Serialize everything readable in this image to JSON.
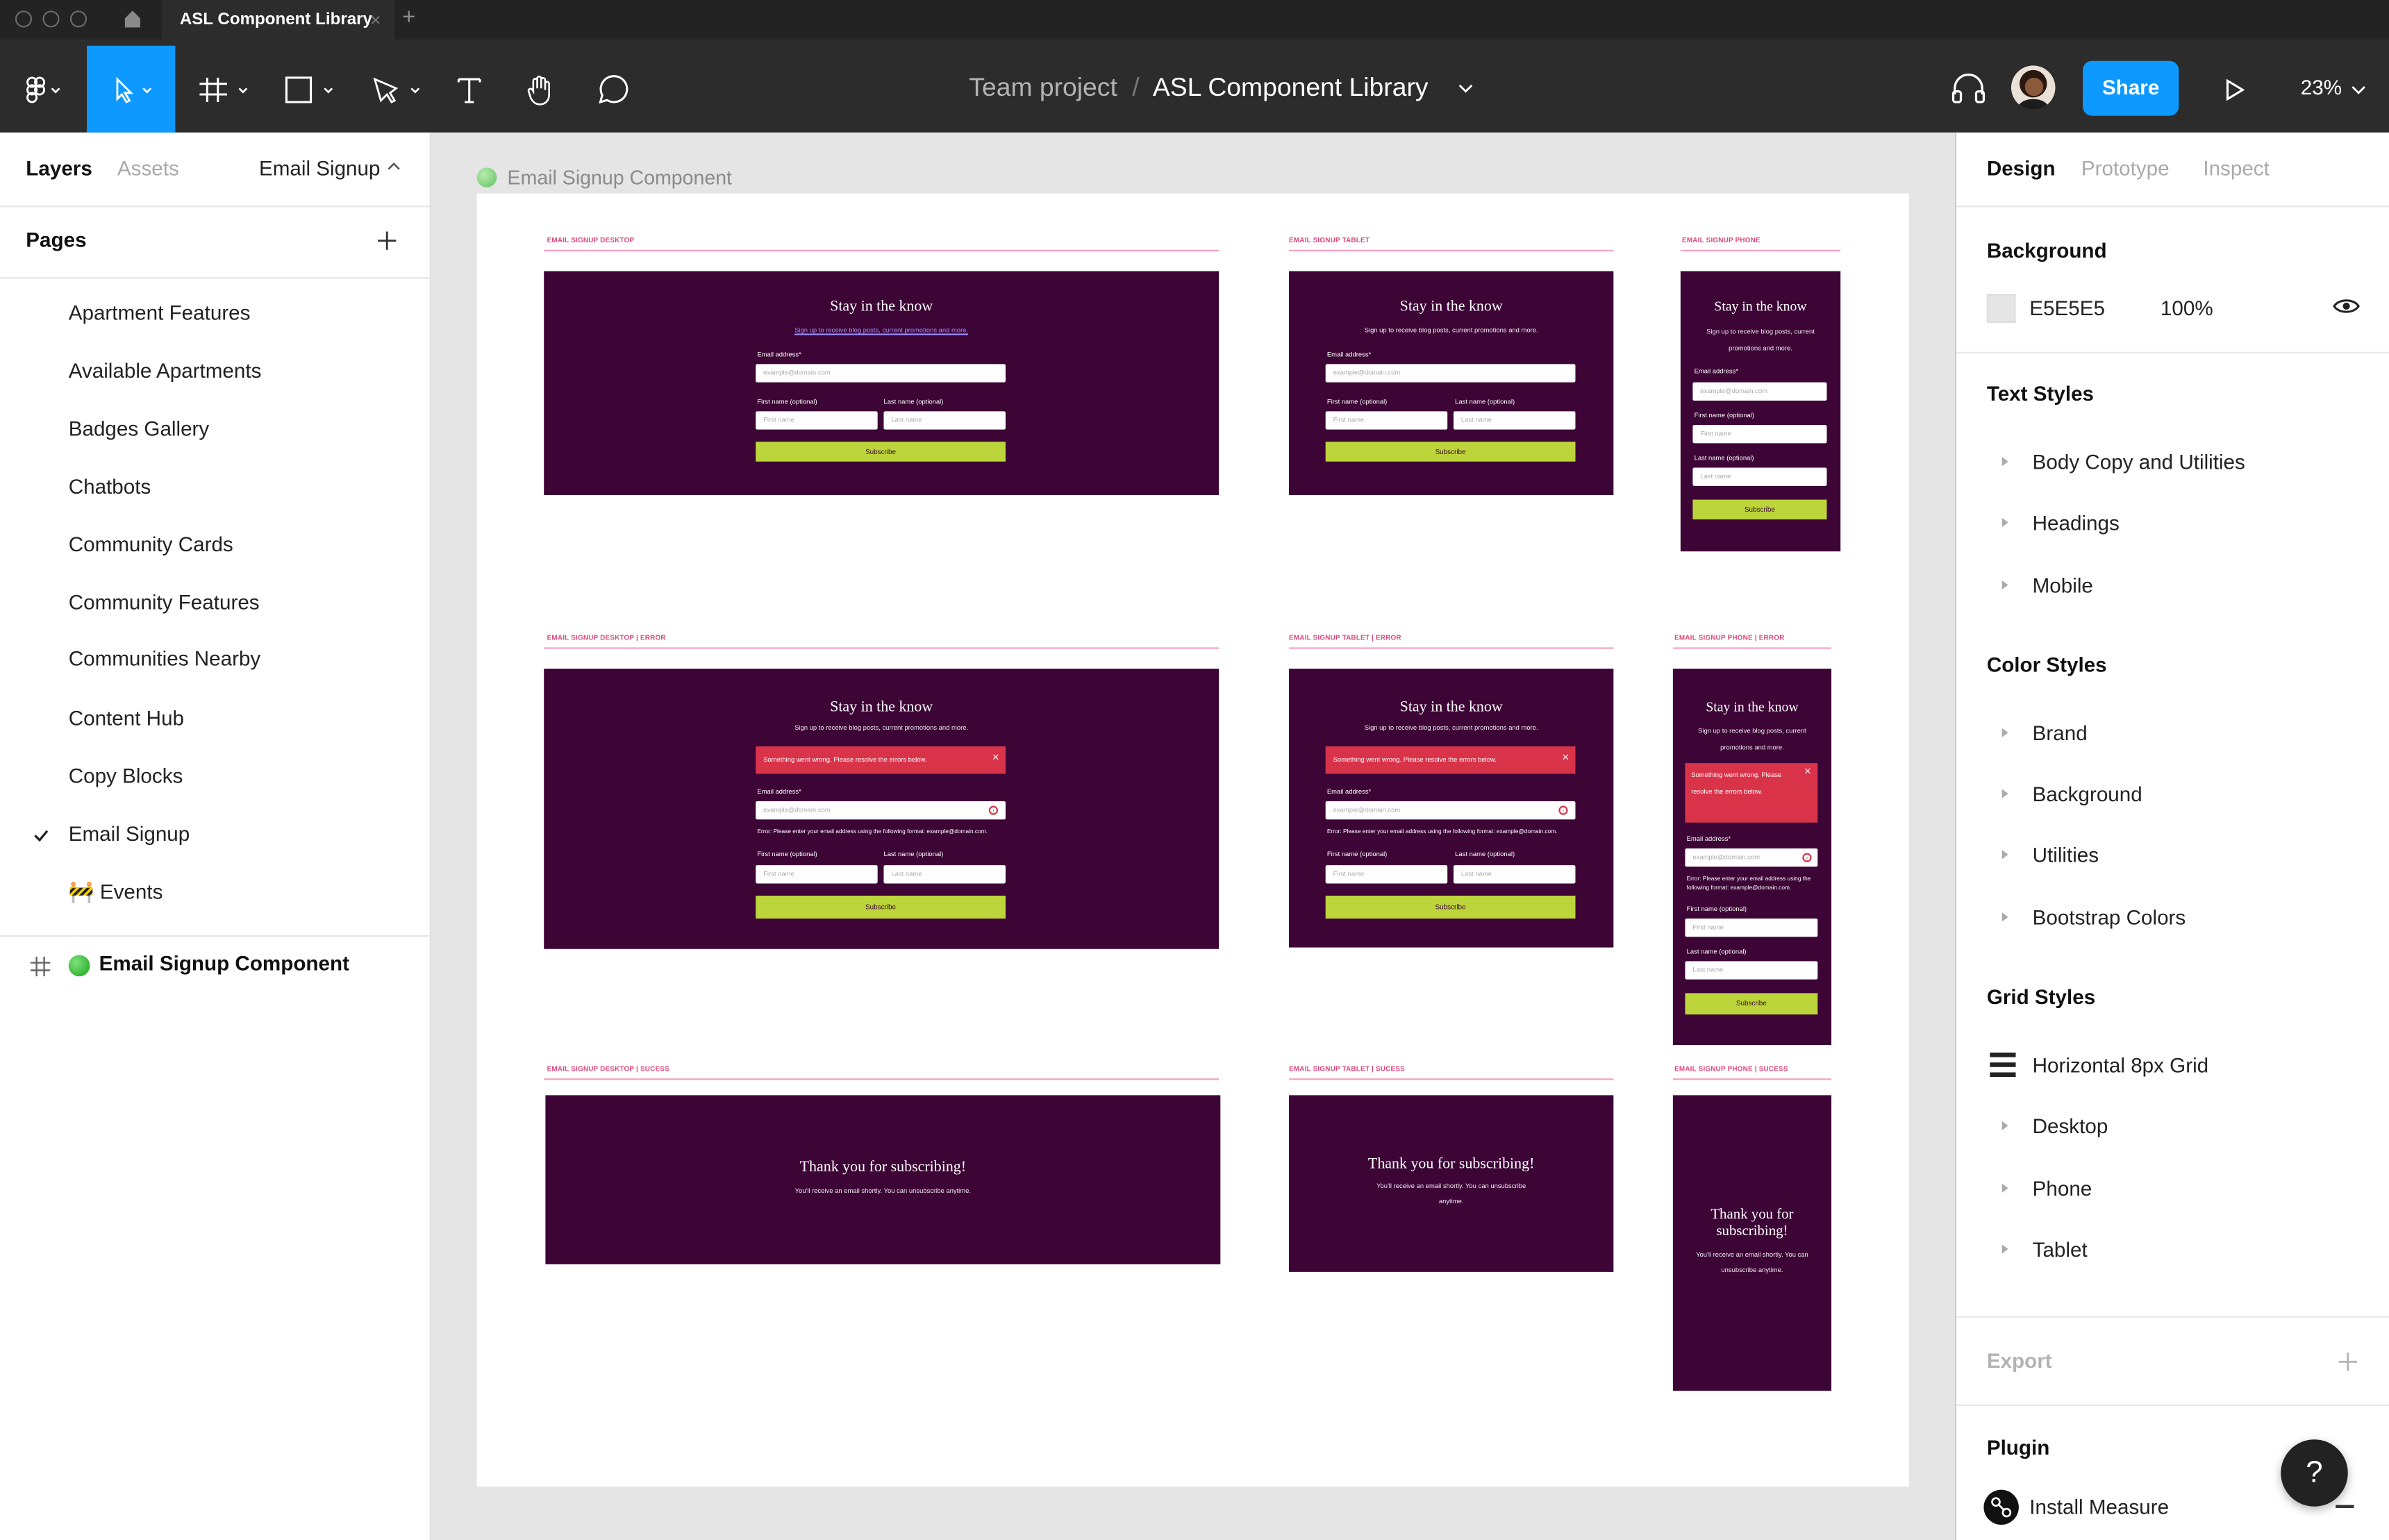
{
  "app": {
    "tab_title": "ASL Component Library",
    "breadcrumb_project": "Team project",
    "breadcrumb_separator": "/",
    "file_name": "ASL Component Library",
    "share_label": "Share",
    "zoom": "23%"
  },
  "left_panel": {
    "tab_layers": "Layers",
    "tab_assets": "Assets",
    "current_page": "Email Signup",
    "pages_heading": "Pages",
    "pages": [
      "Apartment Features",
      "Available Apartments",
      "Badges Gallery",
      "Chatbots",
      "Community Cards",
      "Community Features",
      "Communities Nearby",
      "Content Hub",
      "Copy Blocks",
      "Email Signup",
      "🚧 Events"
    ],
    "selected_page_index": 9,
    "layer_name": "Email Signup Component"
  },
  "canvas": {
    "frame_label": "Email Signup Component",
    "variants": {
      "desktop": "EMAIL SIGNUP DESKTOP",
      "tablet": "EMAIL SIGNUP TABLET",
      "phone": "EMAIL SIGNUP PHONE",
      "desktop_error": "EMAIL SIGNUP DESKTOP | ERROR",
      "tablet_error": "EMAIL SIGNUP TABLET | ERROR",
      "phone_error": "EMAIL SIGNUP PHONE | ERROR",
      "desktop_success": "EMAIL SIGNUP DESKTOP | SUCESS",
      "tablet_success": "EMAIL SIGNUP TABLET | SUCESS",
      "phone_success": "EMAIL SIGNUP PHONE | SUCESS"
    },
    "form": {
      "title": "Stay in the know",
      "subtitle": "Sign up to receive blog posts, current promotions and more.",
      "email_label": "Email address*",
      "email_placeholder": "example@domain.com",
      "first_label": "First name (optional)",
      "first_placeholder": "First name",
      "last_label": "Last name (optional)",
      "last_placeholder": "Last name",
      "button": "Subscribe",
      "error_banner": "Something went wrong. Please resolve the errors below.",
      "error_close": "×",
      "field_error": "Error: Please enter your email address using the following format: example@domain.com.",
      "success_title": "Thank you for subscribing!",
      "success_sub": "You'll receive an email shortly. You can unsubscribe anytime."
    }
  },
  "right_panel": {
    "tab_design": "Design",
    "tab_prototype": "Prototype",
    "tab_inspect": "Inspect",
    "background_heading": "Background",
    "background_hex": "E5E5E5",
    "background_opacity": "100%",
    "text_styles_heading": "Text Styles",
    "text_styles": [
      "Body Copy and Utilities",
      "Headings",
      "Mobile"
    ],
    "color_styles_heading": "Color Styles",
    "color_styles": [
      "Brand",
      "Background",
      "Utilities",
      "Bootstrap Colors"
    ],
    "grid_styles_heading": "Grid Styles",
    "grid_top": "Horizontal 8px Grid",
    "grid_styles": [
      "Desktop",
      "Phone",
      "Tablet"
    ],
    "export_heading": "Export",
    "plugin_heading": "Plugin",
    "plugin_name": "Install Measure",
    "help": "?"
  },
  "colors": {
    "toolbar": "#2c2c2c",
    "accent": "#0d99ff",
    "card": "#3c0536",
    "subscribe": "#bcd53a",
    "error": "#d9334a",
    "label_pink": "#e0457b"
  }
}
